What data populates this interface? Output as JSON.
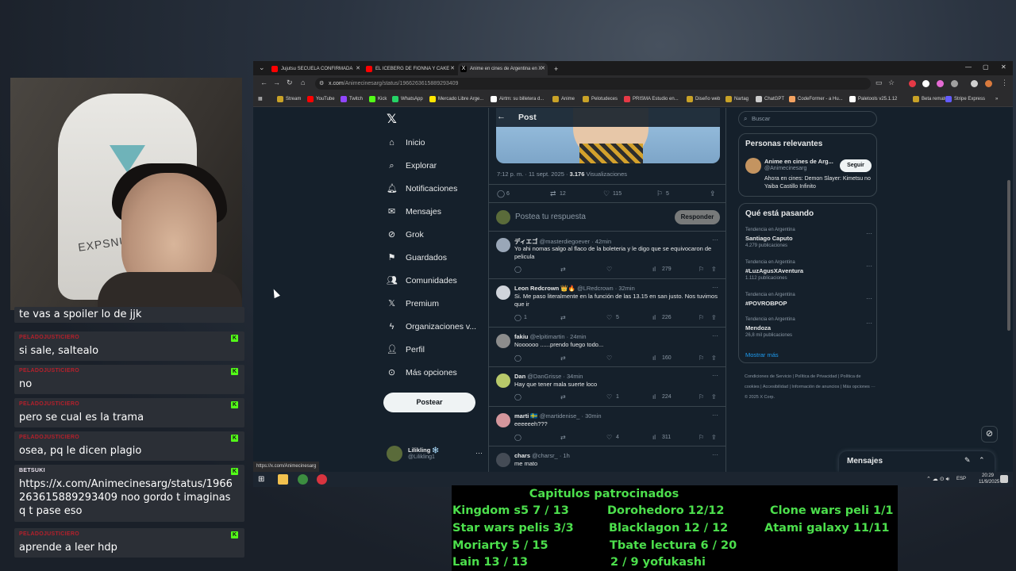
{
  "webcam": {
    "chair_text": "EXPSNUNT"
  },
  "chat": {
    "messages": [
      {
        "user": "",
        "text": "te vas a spoiler lo de jjk",
        "badge": ""
      },
      {
        "user": "PELADOJUSTICIERO",
        "text": "si sale, saltealo",
        "badge": "K"
      },
      {
        "user": "PELADOJUSTICIERO",
        "text": "no",
        "badge": "K"
      },
      {
        "user": "PELADOJUSTICIERO",
        "text": "pero se cual es la trama",
        "badge": "K"
      },
      {
        "user": "PELADOJUSTICIERO",
        "text": "osea, pq le dicen plagio",
        "badge": "K"
      },
      {
        "user": "BETSUKI",
        "text": "https://x.com/Animecinesarg/status/1966263615889293409 noo gordo t imaginas q t pase eso",
        "badge": "K"
      },
      {
        "user": "PELADOJUSTICIERO",
        "text": "aprende a leer hdp",
        "badge": "K"
      }
    ]
  },
  "browser": {
    "tabs": [
      {
        "label": "Jujutsu SECUELA CONFIRMADA",
        "color": "#ff0000"
      },
      {
        "label": "EL ICEBERG DE FIONNA Y CAKE",
        "color": "#ff0000"
      },
      {
        "label": "Anime en cines de Argentina en X",
        "color": "#000000"
      }
    ],
    "new_tab": "+",
    "url_host": "x.com",
    "url_path": "/Animecinesarg/status/1966263615889293409",
    "bookmarks": [
      {
        "label": "Stream",
        "color": "#c9a227"
      },
      {
        "label": "YouTube",
        "color": "#ff0000"
      },
      {
        "label": "Twitch",
        "color": "#9146ff"
      },
      {
        "label": "Kick",
        "color": "#53fc18"
      },
      {
        "label": "WhatsApp",
        "color": "#25d366"
      },
      {
        "label": "Mercado Libre Arge...",
        "color": "#ffe600"
      },
      {
        "label": "Airtm: su billetera d...",
        "color": "#ffffff"
      },
      {
        "label": "Anime",
        "color": "#c9a227"
      },
      {
        "label": "Pelotudeces",
        "color": "#c9a227"
      },
      {
        "label": "PRISMA Estudio en...",
        "color": "#e63946"
      },
      {
        "label": "Diseño web",
        "color": "#c9a227"
      },
      {
        "label": "Nartag",
        "color": "#c9a227"
      },
      {
        "label": "ChatGPT",
        "color": "#cccccc"
      },
      {
        "label": "CodeFormer - a Hu...",
        "color": "#f4a261"
      },
      {
        "label": "Paletools v25.1.12",
        "color": "#ffffff"
      },
      {
        "label": "Beta rematch",
        "color": "#c9a227"
      },
      {
        "label": "Stripe Express",
        "color": "#635bff"
      }
    ],
    "status_url": "https://x.com/Animecinesarg"
  },
  "x": {
    "nav": [
      {
        "label": "Inicio",
        "icon": "home-icon"
      },
      {
        "label": "Explorar",
        "icon": "search-icon"
      },
      {
        "label": "Notificaciones",
        "icon": "bell-icon"
      },
      {
        "label": "Mensajes",
        "icon": "mail-icon"
      },
      {
        "label": "Grok",
        "icon": "grok-icon"
      },
      {
        "label": "Guardados",
        "icon": "bookmark-icon"
      },
      {
        "label": "Comunidades",
        "icon": "people-icon"
      },
      {
        "label": "Premium",
        "icon": "x-icon"
      },
      {
        "label": "Organizaciones v...",
        "icon": "bolt-icon"
      },
      {
        "label": "Perfil",
        "icon": "user-icon"
      },
      {
        "label": "Más opciones",
        "icon": "more-icon"
      }
    ],
    "post_button": "Postear",
    "me": {
      "name": "Lilikling ❄️",
      "handle": "@Lilikling1"
    },
    "header_title": "Post",
    "post_meta": {
      "time": "7:12 p. m. · 11 sept. 2025 · ",
      "views": "3.176",
      "views_label": " Visualizaciones"
    },
    "post_stats": {
      "replies": "6",
      "reposts": "12",
      "likes": "115",
      "bookmarks": "5"
    },
    "reply_placeholder": "Postea tu respuesta",
    "reply_button": "Responder",
    "replies": [
      {
        "name": "ディエゴ",
        "handle": "@masterdiegoever · 42min",
        "text": "Yo ahi nomas salgo al flaco de la boleteria y le digo que se equivocaron de pelicula",
        "reply": "",
        "repost": "",
        "like": "",
        "views": "279",
        "avatar": "#9aa7b8"
      },
      {
        "name": "Leon Redcrown 👑🔥",
        "handle": "@LRedcrown · 32min",
        "text": "Si. Me paso literalmente en la función de las 13.15 en san justo. Nos tuvimos que ir",
        "reply": "1",
        "repost": "",
        "like": "5",
        "views": "226",
        "avatar": "#d0d4db"
      },
      {
        "name": "fakiu",
        "handle": "@elpitimartin · 24min",
        "text": "Noooooo ......prendo fuego todo...",
        "reply": "",
        "repost": "",
        "like": "",
        "views": "160",
        "avatar": "#8c8c8c"
      },
      {
        "name": "Dan",
        "handle": "@DanGrisse · 34min",
        "text": "Hay que tener mala suerte loco",
        "reply": "",
        "repost": "",
        "like": "1",
        "views": "224",
        "avatar": "#b8c96a"
      },
      {
        "name": "marti 🇸🇪",
        "handle": "@martidenise_ · 30min",
        "text": "eeeeeeh???",
        "reply": "",
        "repost": "",
        "like": "4",
        "views": "311",
        "avatar": "#d4969c"
      },
      {
        "name": "chars",
        "handle": "@charsr_ · 1h",
        "text": "me mato",
        "reply": "",
        "repost": "",
        "like": "",
        "views": "",
        "avatar": "#444b55"
      }
    ],
    "search_placeholder": "Buscar",
    "relevant": {
      "title": "Personas relevantes",
      "name": "Anime en cines de Arg...",
      "handle": "@Animecinesarg",
      "follow": "Seguir",
      "bio": "Ahora en cines: Demon Slayer: Kimetsu no Yaiba Castillo Infinito"
    },
    "trends_title": "Qué está pasando",
    "trends": [
      {
        "context": "Tendencia en Argentina",
        "name": "Santiago Caputo",
        "count": "4.279 publicaciones"
      },
      {
        "context": "Tendencia en Argentina",
        "name": "#LuzAgusXAventura",
        "count": "1.112 publicaciones"
      },
      {
        "context": "Tendencia en Argentina",
        "name": "#POVROBPOP",
        "count": ""
      },
      {
        "context": "Tendencia en Argentina",
        "name": "Mendoza",
        "count": "26,8 mil publicaciones"
      }
    ],
    "show_more": "Mostrar más",
    "footer": "Condiciones de Servicio  |  Política de Privacidad  |  Política de cookies  |  Accesibilidad  |  Información de anuncios  |  Más opciones ···  © 2025 X Corp.",
    "messages_drawer": "Mensajes"
  },
  "taskbar": {
    "lang": "ESP",
    "time": "20:29",
    "date": "11/9/2025"
  },
  "sponsor": {
    "title": "Capitulos patrocinados",
    "items": [
      "Kingdom s5 7 / 13",
      "Dorohedoro 12/12",
      "Clone wars peli 1/1",
      "Star wars pelis 3/3",
      "Blacklagon 12 / 12",
      "Atami galaxy 11/11",
      "Moriarty 5 / 15",
      "Tbate lectura 6 / 20",
      "Lain 13 / 13",
      "2 / 9 yofukashi"
    ]
  }
}
